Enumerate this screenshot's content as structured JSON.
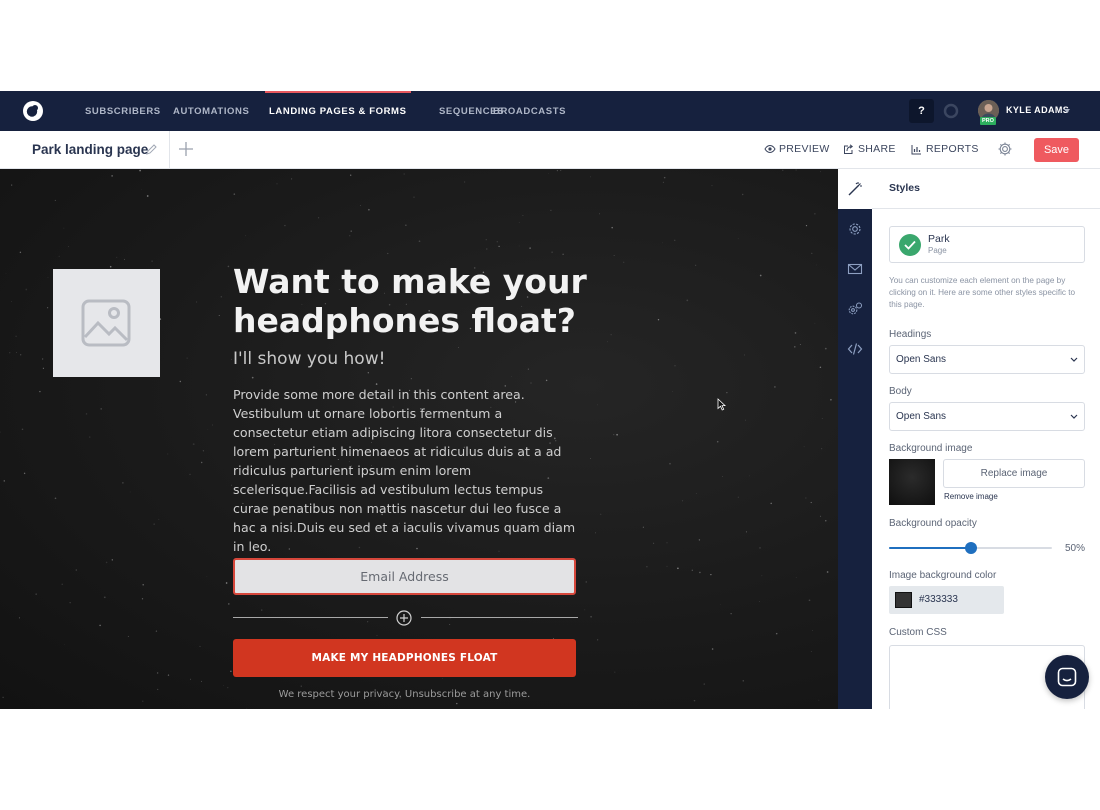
{
  "nav": {
    "items": [
      {
        "label": "SUBSCRIBERS"
      },
      {
        "label": "AUTOMATIONS"
      },
      {
        "label": "LANDING PAGES & FORMS"
      },
      {
        "label": "SEQUENCES"
      },
      {
        "label": "BROADCASTS"
      }
    ],
    "active_item": "LANDING PAGES & FORMS",
    "help_label": "?",
    "user_name": "KYLE ADAMS",
    "user_badge": "PRO"
  },
  "toolbar": {
    "page_title": "Park landing page",
    "preview_label": "PREVIEW",
    "share_label": "SHARE",
    "reports_label": "REPORTS",
    "save_label": "Save"
  },
  "landing": {
    "headline": "Want to make your headphones float?",
    "subheadline": "I'll show you how!",
    "body": "Provide some more detail in this content area. Vestibulum ut ornare lobortis fermentum a consectetur etiam adipiscing litora consectetur dis lorem parturient himenaeos at ridiculus duis at a ad ridiculus parturient ipsum enim lorem scelerisque.Facilisis ad vestibulum lectus tempus curae penatibus non mattis nascetur dui leo fusce a hac a nisi.Duis eu sed et a iaculis vivamus quam diam in leo.",
    "email_placeholder": "Email Address",
    "cta_label": "MAKE MY HEADPHONES FLOAT",
    "privacy_text": "We respect your privacy. Unsubscribe at any time."
  },
  "styles_panel": {
    "title": "Styles",
    "template_name": "Park",
    "template_type": "Page",
    "help_text": "You can customize each element on the page by clicking on it. Here are some other styles specific to this page.",
    "headings_label": "Headings",
    "headings_value": "Open Sans",
    "body_label": "Body",
    "body_value": "Open Sans",
    "bg_image_label": "Background image",
    "replace_image_label": "Replace image",
    "remove_image_label": "Remove image",
    "bg_opacity_label": "Background opacity",
    "bg_opacity_value": 0.5,
    "bg_opacity_text": "50%",
    "image_bg_color_label": "Image background color",
    "image_bg_color_value": "#333333",
    "custom_css_label": "Custom CSS"
  },
  "colors": {
    "nav_bg": "#16213e",
    "save_button": "#ef5a5f",
    "cta": "#d13620",
    "active_accent": "#e8585e",
    "check": "#3aa76d",
    "slider": "#1f6fbf"
  },
  "icons": {
    "logo": "convertkit-logo-icon",
    "pencil": "pencil-icon",
    "plus": "plus-icon",
    "preview": "eye-icon",
    "share": "share-icon",
    "reports": "bar-chart-icon",
    "settings": "gear-icon",
    "rail": [
      "magic-wand-icon",
      "gear-icon",
      "envelope-icon",
      "gears-icon",
      "code-icon"
    ],
    "chat": "chat-icon"
  }
}
